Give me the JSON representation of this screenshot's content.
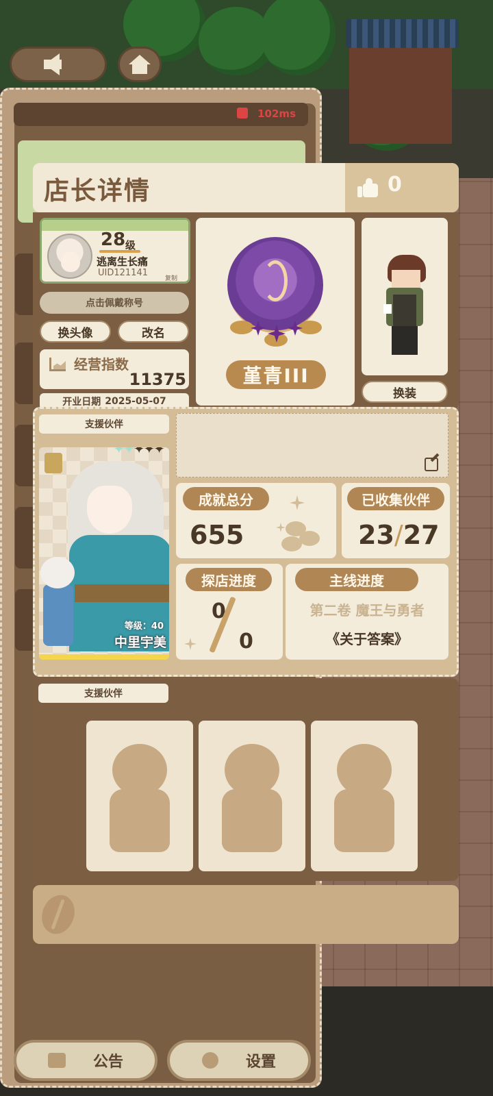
{
  "network": {
    "ping": "102ms"
  },
  "modal": {
    "title": "店长详情",
    "likes": "0"
  },
  "profile": {
    "level": "28",
    "level_unit": "级",
    "name": "逃离生长痛",
    "uid": "UID121141",
    "copy_label": "复制",
    "wear_title_label": "点击佩戴称号",
    "change_avatar_label": "换头像",
    "rename_label": "改名",
    "business_index_label": "经营指数",
    "business_index_value": "11375",
    "open_date_label": "开业日期",
    "open_date_value": "2025-05-07"
  },
  "rank": {
    "name": "堇青III"
  },
  "outfit": {
    "change_label": "换装"
  },
  "support": {
    "tag_label": "支援伙伴",
    "partner": {
      "level_label": "等级：40",
      "name": "中里宇美",
      "stars_total": 5,
      "stars_lit": 2
    },
    "message": ""
  },
  "stats": {
    "achievement_label": "成就总分",
    "achievement_value": "655",
    "collected_label": "已收集伙伴",
    "collected_current": "23",
    "collected_total": "27",
    "explore_label": "探店进度",
    "explore_current": "0",
    "explore_total": "0",
    "main_label": "主线进度",
    "main_volume": "第二卷 魔王与勇者",
    "main_chapter": "《关于答案》"
  },
  "support_team": {
    "tag_label": "支援伙伴",
    "slots": [
      "",
      "",
      ""
    ]
  },
  "bottom": {
    "notice_label": "公告",
    "settings_label": "设置"
  },
  "icons": {
    "back": "arrow-left-icon",
    "home": "home-icon",
    "like": "thumbs-up-icon",
    "edit": "edit-icon",
    "bean": "coffee-bean-icon"
  },
  "colors": {
    "panel_brown": "#7c5e42",
    "card_cream": "#f3ecdb",
    "accent_tan": "#b08654",
    "ping_red": "#dd4444"
  }
}
